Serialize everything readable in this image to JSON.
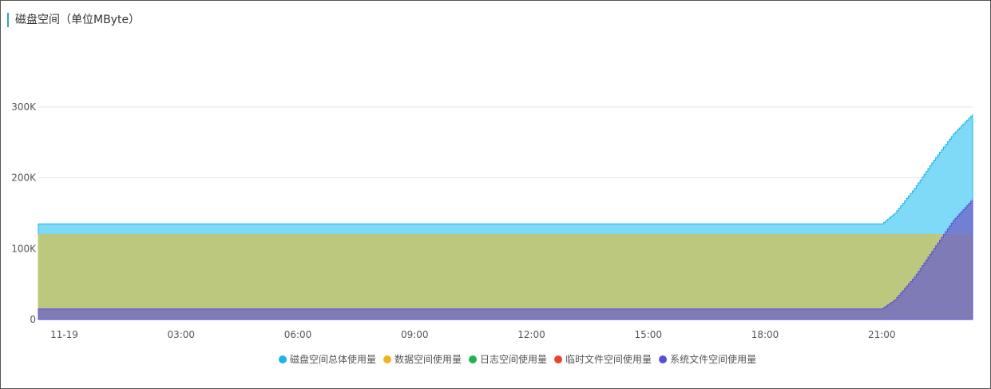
{
  "panel": {
    "title": "磁盘空间（单位MByte）"
  },
  "chart_data": {
    "type": "area",
    "title": "磁盘空间（单位MByte）",
    "x_start": "11-19 00:00",
    "x_end": "11-19 24:00",
    "x_ticks": [
      "11-19",
      "03:00",
      "06:00",
      "09:00",
      "12:00",
      "15:00",
      "18:00",
      "21:00"
    ],
    "y_ticks": [
      "0",
      "100K",
      "200K",
      "300K"
    ],
    "ylim": [
      0,
      300000
    ],
    "grid": true,
    "legend_position": "bottom-center",
    "series": [
      {
        "name": "磁盘空间总体使用量",
        "color": "#1ab6e8",
        "points": [
          [
            "00:00",
            135000
          ],
          [
            "21:40",
            135000
          ],
          [
            "22:00",
            150000
          ],
          [
            "22:30",
            185000
          ],
          [
            "23:00",
            225000
          ],
          [
            "23:30",
            262000
          ],
          [
            "24:00",
            290000
          ]
        ]
      },
      {
        "name": "数据空间使用量",
        "color": "#f0b323",
        "points": [
          [
            "00:00",
            120000
          ],
          [
            "24:00",
            120000
          ]
        ]
      },
      {
        "name": "日志空间使用量",
        "color": "#22b14c",
        "points": [
          [
            "00:00",
            0
          ],
          [
            "24:00",
            0
          ]
        ]
      },
      {
        "name": "临时文件空间使用量",
        "color": "#e8442f",
        "points": [
          [
            "00:00",
            0
          ],
          [
            "24:00",
            0
          ]
        ]
      },
      {
        "name": "系统文件空间使用量",
        "color": "#5a4fd6",
        "points": [
          [
            "00:00",
            15000
          ],
          [
            "21:40",
            15000
          ],
          [
            "22:00",
            28000
          ],
          [
            "22:30",
            60000
          ],
          [
            "23:00",
            100000
          ],
          [
            "23:30",
            140000
          ],
          [
            "24:00",
            170000
          ]
        ]
      }
    ]
  }
}
